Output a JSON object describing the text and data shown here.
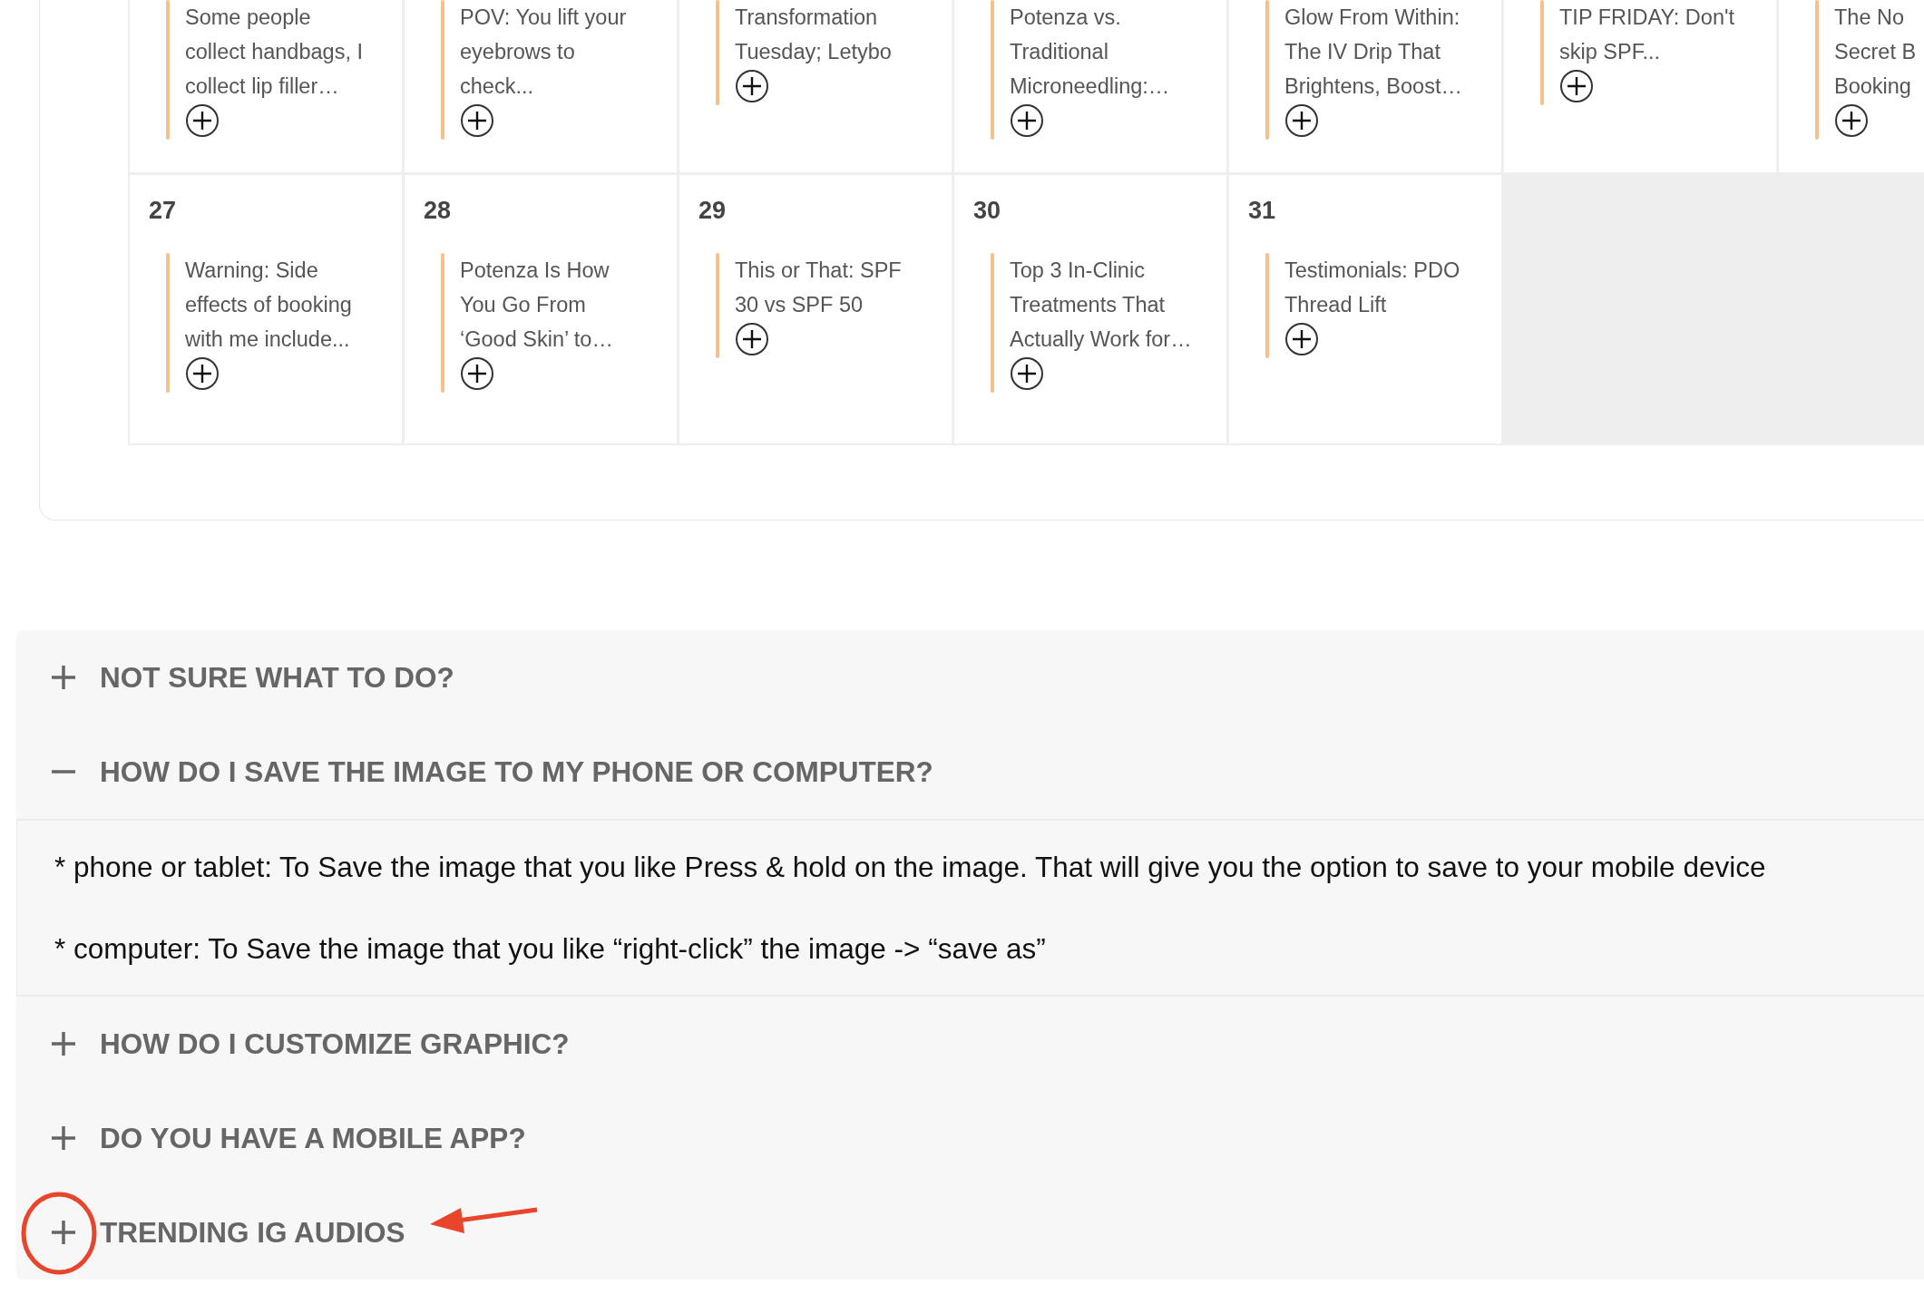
{
  "calendar": {
    "weeks": [
      {
        "days": [
          {
            "kind": "day",
            "events": [
              "Some people\ncollect handbags, I\ncollect lip filler…"
            ]
          },
          {
            "kind": "day",
            "events": [
              "POV: You lift your\neyebrows to\ncheck..."
            ]
          },
          {
            "kind": "day",
            "events": [
              "Transformation\nTuesday; Letybo"
            ]
          },
          {
            "kind": "day",
            "events": [
              "Potenza vs.\nTraditional\nMicroneedling:…"
            ]
          },
          {
            "kind": "day",
            "events": [
              "Glow From Within:\nThe IV Drip That\nBrightens, Boost…"
            ]
          },
          {
            "kind": "day",
            "events": [
              "TIP FRIDAY: Don't\nskip SPF..."
            ]
          },
          {
            "kind": "day",
            "events": [
              "The No\nSecret B\nBooking"
            ]
          }
        ]
      },
      {
        "days": [
          {
            "kind": "day",
            "date": "27",
            "events": [
              "Warning: Side\neffects of booking\nwith me include..."
            ]
          },
          {
            "kind": "day",
            "date": "28",
            "events": [
              "Potenza Is How\nYou Go From\n‘Good Skin’ to…"
            ]
          },
          {
            "kind": "day",
            "date": "29",
            "events": [
              "This or That: SPF\n30 vs SPF 50"
            ]
          },
          {
            "kind": "day",
            "date": "30",
            "events": [
              "Top 3 In-Clinic\nTreatments That\nActually Work for…"
            ]
          },
          {
            "kind": "day",
            "date": "31",
            "events": [
              "Testimonials: PDO\nThread Lift"
            ]
          },
          {
            "kind": "empty"
          },
          {
            "kind": "empty"
          }
        ]
      }
    ]
  },
  "faq": [
    {
      "question": "NOT SURE WHAT TO DO?",
      "expanded": false,
      "highlighted": false
    },
    {
      "question": "HOW DO I SAVE THE IMAGE TO MY PHONE OR COMPUTER?",
      "expanded": true,
      "highlighted": false,
      "answer": [
        "* phone or tablet: To Save the image that you like Press & hold on the image. That will give you the option to save to your mobile device",
        "* computer: To Save the image that you like “right-click” the image -> “save as”"
      ]
    },
    {
      "question": "HOW DO I CUSTOMIZE GRAPHIC?",
      "expanded": false,
      "highlighted": false
    },
    {
      "question": "DO YOU HAVE A MOBILE APP?",
      "expanded": false,
      "highlighted": false
    },
    {
      "question": "TRENDING IG AUDIOS",
      "expanded": false,
      "highlighted": true
    }
  ]
}
